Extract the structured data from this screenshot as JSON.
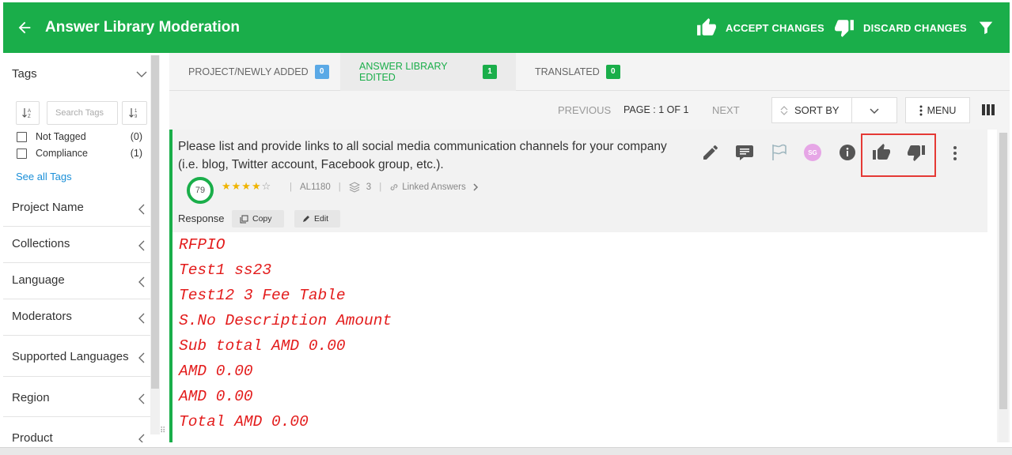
{
  "header": {
    "title": "Answer Library Moderation",
    "accept_label": "ACCEPT CHANGES",
    "discard_label": "DISCARD CHANGES"
  },
  "sidebar": {
    "tags_heading": "Tags",
    "search_placeholder": "Search Tags",
    "tags": [
      {
        "name": "Not Tagged",
        "count": "(0)"
      },
      {
        "name": "Compliance",
        "count": "(1)"
      }
    ],
    "see_all": "See all Tags",
    "sections": [
      "Project Name",
      "Collections",
      "Language",
      "Moderators",
      "Supported Languages",
      "Region",
      "Product"
    ]
  },
  "tabs": [
    {
      "label": "PROJECT/NEWLY ADDED",
      "count": "0",
      "color": "#5aa9e6",
      "active": false
    },
    {
      "label": "ANSWER LIBRARY EDITED",
      "count": "1",
      "color": "#1aae4a",
      "active": true
    },
    {
      "label": "TRANSLATED",
      "count": "0",
      "color": "#1aae4a",
      "active": false
    }
  ],
  "toolbar": {
    "previous": "PREVIOUS",
    "page_info": "PAGE : 1 OF 1",
    "next": "NEXT",
    "sort_by": "SORT BY",
    "menu": "MENU"
  },
  "card": {
    "question": "Please list and provide links to all social media communication channels for your company (i.e. blog, Twitter account, Facebook group, etc.).",
    "score": "79",
    "rating": 4,
    "id": "AL1180",
    "layers": "3",
    "linked_answers": "Linked Answers",
    "avatar_initials": "SG",
    "response_label": "Response",
    "copy_label": "Copy",
    "edit_label": "Edit",
    "response_lines": [
      "RFPIO",
      "Test1 ss23",
      "Test12 3 Fee Table",
      "S.No Description Amount",
      "Sub total AMD 0.00",
      "AMD 0.00",
      "AMD 0.00",
      "Total AMD 0.00"
    ]
  },
  "colors": {
    "brand": "#1aae4a",
    "response_text": "#e31c1c",
    "highlight": "#e53935",
    "link": "#1a8fd8"
  }
}
